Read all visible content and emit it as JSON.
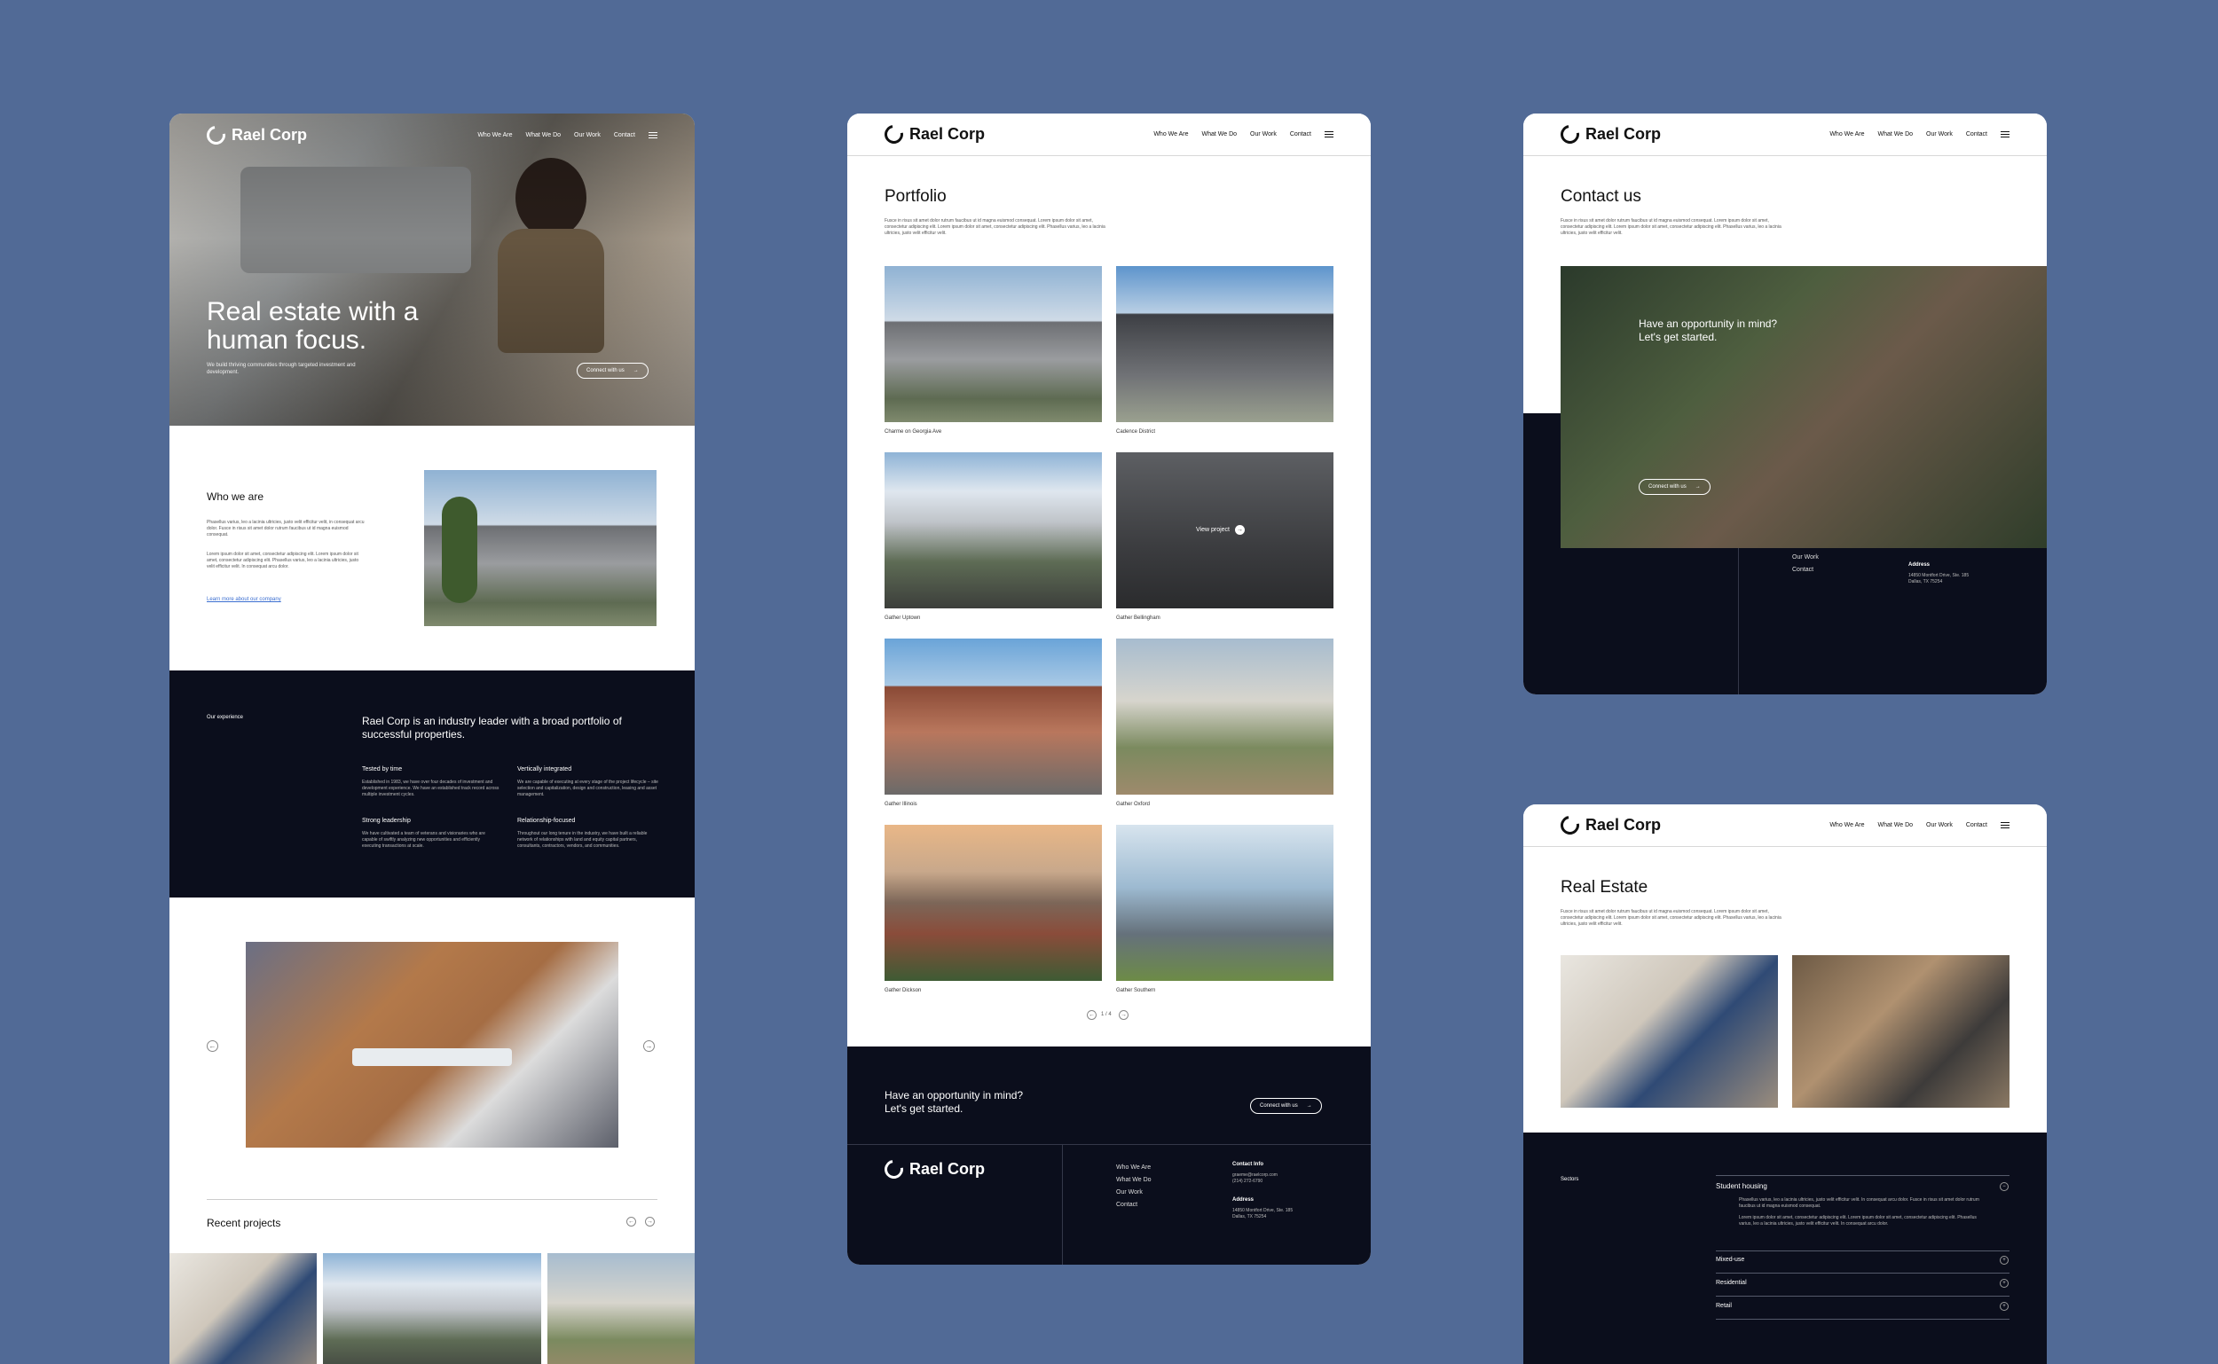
{
  "brand": "Rael Corp",
  "nav": [
    "Who We Are",
    "What We Do",
    "Our Work",
    "Contact"
  ],
  "home": {
    "hero_title_line1": "Real estate with a",
    "hero_title_line2": "human focus.",
    "hero_sub": "We build thriving communities through targeted investment and development.",
    "hero_cta": "Connect with us",
    "who_title": "Who we are",
    "who_p1": "Phasellus varius, leo a lacinia ultricies, justo velit efficitur velit, in consequat arcu dolor. Fusce in risus sit amet dolor rutrum faucibus ut id magna euismod consequat.",
    "who_p2": "Lorem ipsum dolor sit amet, consectetur adipiscing elit. Lorem ipsum dolor sit amet, consectetur adipiscing elit. Phasellus varius, leo a lacinia ultricies, justo velit efficitur velit. In consequat arcu dolor.",
    "who_link": "Learn more about our company",
    "exp_label": "Our experience",
    "exp_title": "Rael Corp is an industry leader with a broad portfolio of successful properties.",
    "features": [
      {
        "title": "Tested by time",
        "text": "Established in 1983, we have over four decades of investment and development experience. We have an established track record across multiple investment cycles."
      },
      {
        "title": "Vertically integrated",
        "text": "We are capable of executing at every stage of the project lifecycle – site selection and capitalization, design and construction, leasing and asset management."
      },
      {
        "title": "Strong leadership",
        "text": "We have cultivated a team of veterans and visionaries who are capable of swiftly analyzing new opportunities and efficiently executing transactions at scale."
      },
      {
        "title": "Relationship-focused",
        "text": "Throughout our long tenure in the industry, we have built a reliable network of relationships with land and equity capital partners, consultants, contractors, vendors, and communities."
      }
    ],
    "recent_title": "Recent projects"
  },
  "portfolio": {
    "title": "Portfolio",
    "intro": "Fusce in risus sit amet dolor rutrum faucibus ut id magna euismod consequat. Lorem ipsum dolor sit amet, consectetur adipiscing elit. Lorem ipsum dolor sit amet, consectetur adipiscing elit. Phasellus varius, leo a lacinia ultricies, justo velit efficitur velit.",
    "items": [
      "Charme on Georgia Ave",
      "Cadence District",
      "Gather Uptown",
      "Gather Bellingham",
      "Gather Illinois",
      "Gather Oxford",
      "Gather Dickson",
      "Gather Southern"
    ],
    "view_project": "View project",
    "pager": "1 / 4",
    "cta_line1": "Have an opportunity in mind?",
    "cta_line2": "Let's get started.",
    "cta_button": "Connect with us"
  },
  "footer": {
    "links": [
      "Who We Are",
      "What We Do",
      "Our Work",
      "Contact"
    ],
    "contact_label": "Contact Info",
    "email": "graeme@raelcorp.com",
    "phone": "(214) 272-6790",
    "address_label": "Address",
    "address1": "14850 Montfort Drive, Ste. 185",
    "address2": "Dallas, TX 75254"
  },
  "contact": {
    "title": "Contact us",
    "intro": "Fusce in risus sit amet dolor rutrum faucibus ut id magna euismod consequat. Lorem ipsum dolor sit amet, consectetur adipiscing elit. Lorem ipsum dolor sit amet, consectetur adipiscing elit. Phasellus varius, leo a lacinia ultricies, justo velit efficitur velit.",
    "cta_line1": "Have an opportunity in mind?",
    "cta_line2": "Let's get started.",
    "cta_button": "Connect with us"
  },
  "realestate": {
    "title": "Real Estate",
    "intro": "Fusce in risus sit amet dolor rutrum faucibus ut id magna euismod consequat. Lorem ipsum dolor sit amet, consectetur adipiscing elit. Lorem ipsum dolor sit amet, consectetur adipiscing elit. Phasellus varius, leo a lacinia ultricies, justo velit efficitur velit.",
    "sectors_label": "Sectors",
    "sectors": [
      "Student housing",
      "Mixed-use",
      "Residential",
      "Retail"
    ],
    "sector_text1": "Phasellus varius, leo a lacinia ultricies, justo velit efficitur velit. In consequat arcu dolor. Fusce in risus sit amet dolor rutrum faucibus ut id magna euismod consequat.",
    "sector_text2": "Lorem ipsum dolor sit amet, consectetur adipiscing elit. Lorem ipsum dolor sit amet, consectetur adipiscing elit. Phasellus varius, leo a lacinia ultricies, justo velit efficitur velit. In consequat arcu dolor."
  }
}
